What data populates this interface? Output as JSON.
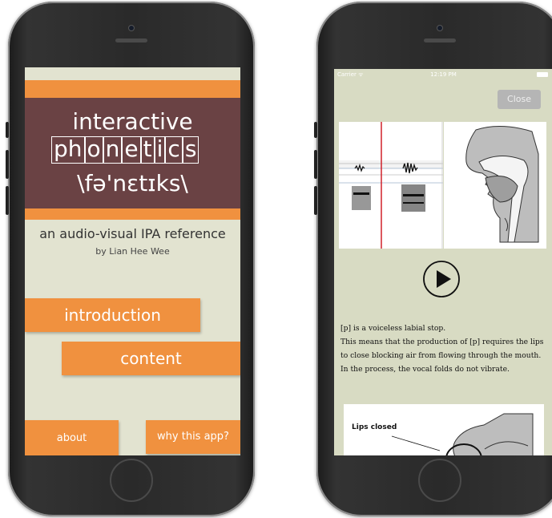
{
  "left_app": {
    "title_line1": "interactive",
    "title_letters": [
      "ph",
      "o",
      "n",
      "e",
      "t",
      "i",
      "c",
      "s"
    ],
    "title_ipa": "\\fə'nɛtɪks\\",
    "subtitle": "an audio-visual IPA reference",
    "byline": "by Lian Hee Wee",
    "intro_label": "introduction",
    "content_label": "content",
    "about_label": "about",
    "why_label": "why this app?"
  },
  "right_app": {
    "status": {
      "carrier": "Carrier ᯤ",
      "time": "12:19 PM"
    },
    "close_label": "Close",
    "description": [
      "[p] is a voiceless labial stop.",
      "This means that the production of [p] requires the lips to close blocking air from flowing through the mouth.",
      "In the process, the vocal folds do not vibrate."
    ],
    "lips_label": "Lips closed"
  },
  "colors": {
    "orange": "#f0913f",
    "title_bg": "#6a4244",
    "left_bg": "#e2e3d0",
    "right_bg": "#d8dbc3"
  }
}
